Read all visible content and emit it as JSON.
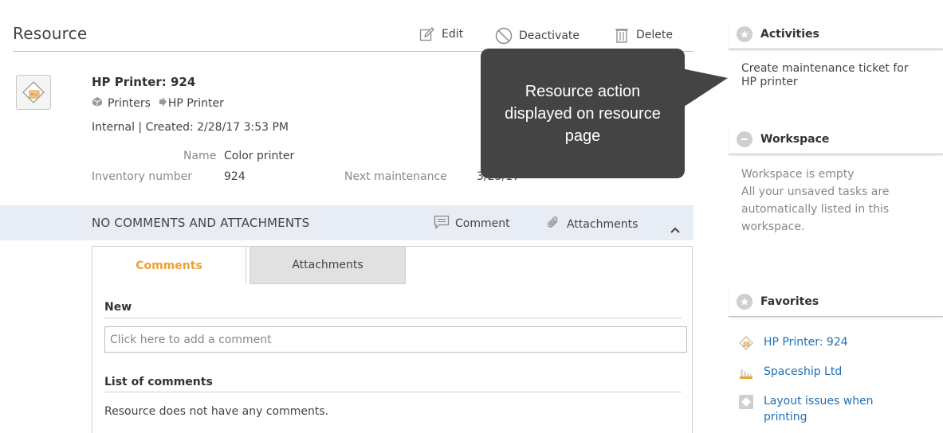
{
  "header": {
    "title": "Resource",
    "actions": [
      {
        "label": "Edit",
        "icon": "edit-icon"
      },
      {
        "label": "Deactivate",
        "icon": "deactivate-icon"
      },
      {
        "label": "Delete",
        "icon": "trash-icon"
      }
    ]
  },
  "resource": {
    "title": "HP Printer: 924",
    "breadcrumb": [
      "Printers",
      "HP Printer"
    ],
    "meta": "Internal | Created: 2/28/17 3:53 PM",
    "fields": {
      "name_label": "Name",
      "name_value": "Color printer",
      "inventory_label": "Inventory number",
      "inventory_value": "924",
      "maintenance_label": "Next maintenance",
      "maintenance_value": "3/23/17"
    }
  },
  "comments": {
    "band_title": "NO COMMENTS AND ATTACHMENTS",
    "comment_action": "Comment",
    "attachments_action": "Attachments",
    "tabs": [
      "Comments",
      "Attachments"
    ],
    "new_label": "New",
    "input_placeholder": "Click here to add a comment",
    "list_label": "List of comments",
    "empty_text": "Resource does not have any comments."
  },
  "callout": {
    "text": "Resource action displayed on resource page"
  },
  "sidebar": {
    "activities": {
      "title": "Activities",
      "text_line1": "Create maintenance ticket for",
      "text_line2": "HP printer"
    },
    "workspace": {
      "title": "Workspace",
      "line1": "Workspace is empty",
      "line2": "All your unsaved tasks are",
      "line3": "automatically listed in this",
      "line4": "workspace."
    },
    "favorites": {
      "title": "Favorites",
      "items": [
        {
          "label": "HP Printer: 924",
          "icon": "printer-icon"
        },
        {
          "label": "Spaceship Ltd",
          "icon": "building-icon"
        },
        {
          "label_line1": "Layout issues when",
          "label_line2": "printing",
          "icon": "ticket-icon"
        }
      ]
    }
  },
  "colors": {
    "accent_orange": "#f0a030",
    "link_blue": "#1f6fb2",
    "band_bg": "#e8edf5",
    "callout_bg": "#444444"
  }
}
